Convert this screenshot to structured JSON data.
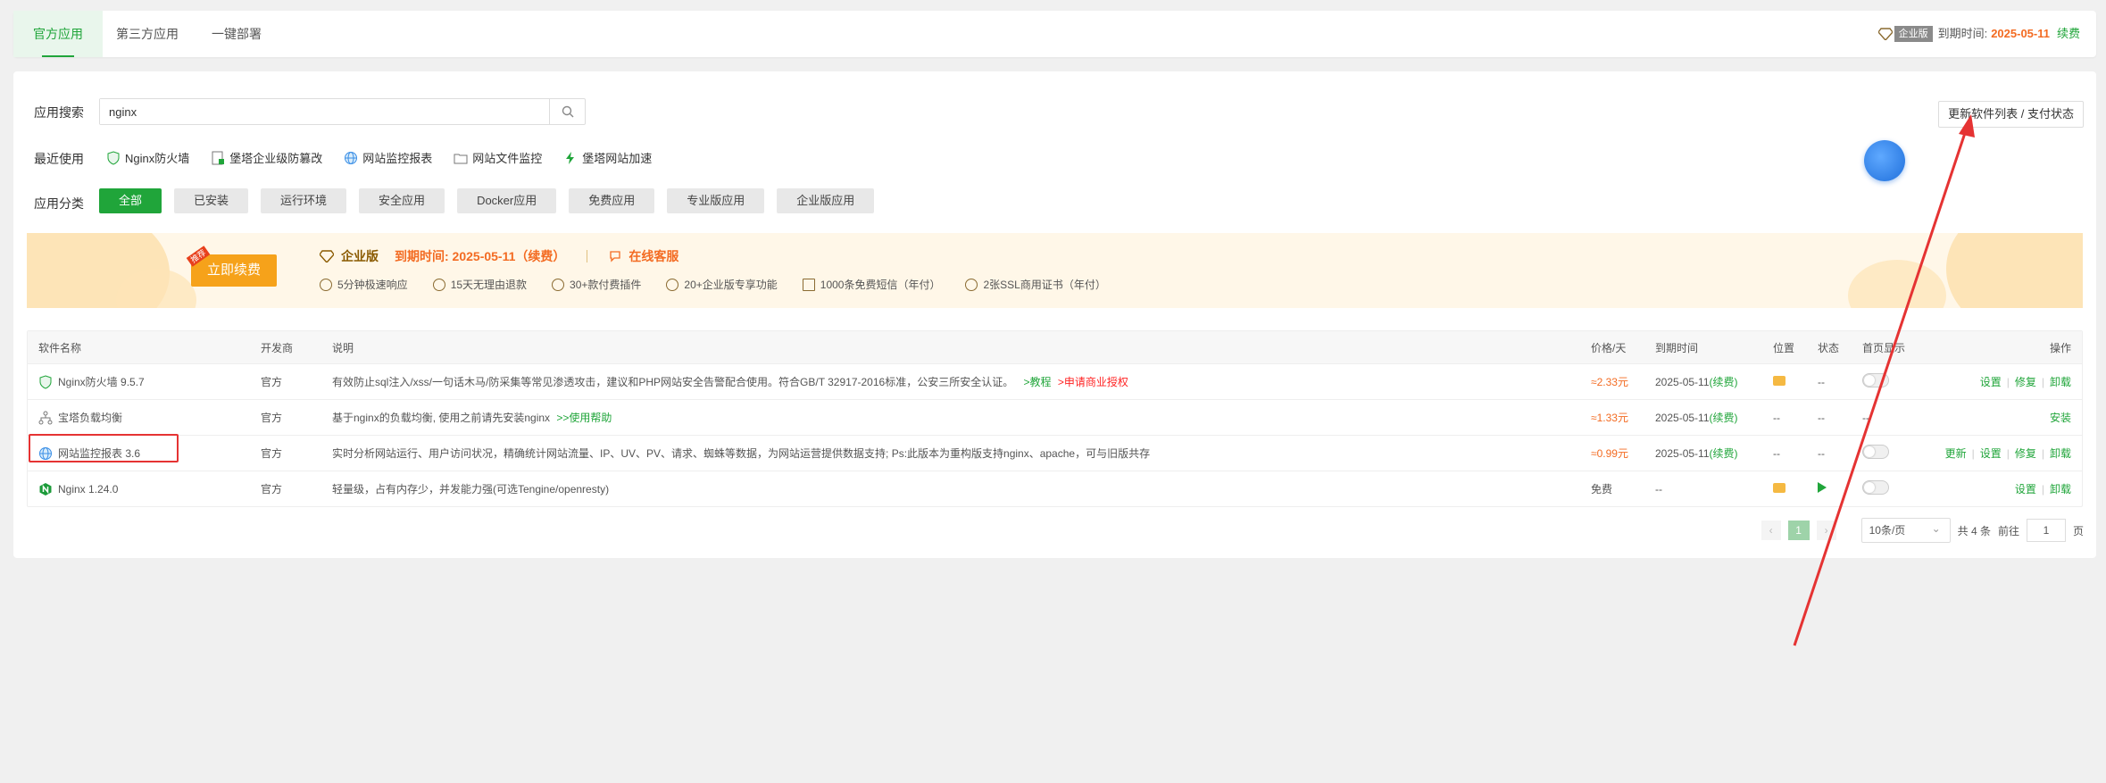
{
  "tabs": [
    "官方应用",
    "第三方应用",
    "一键部署"
  ],
  "expire_bar": {
    "badge": "企业版",
    "label": "到期时间:",
    "date": "2025-05-11",
    "renew": "续费"
  },
  "search": {
    "label": "应用搜索",
    "value": "nginx"
  },
  "update_button": "更新软件列表 / 支付状态",
  "recent": {
    "label": "最近使用",
    "items": [
      "Nginx防火墙",
      "堡塔企业级防篡改",
      "网站监控报表",
      "网站文件监控",
      "堡塔网站加速"
    ]
  },
  "category": {
    "label": "应用分类",
    "items": [
      "全部",
      "已安装",
      "运行环境",
      "安全应用",
      "Docker应用",
      "免费应用",
      "专业版应用",
      "企业版应用"
    ]
  },
  "banner": {
    "renew_btn": "立即续费",
    "renew_tag": "推荐",
    "edition": "企业版",
    "expire": "到期时间: 2025-05-11（续费）",
    "service": "在线客服",
    "features": [
      "5分钟极速响应",
      "15天无理由退款",
      "30+款付费插件",
      "20+企业版专享功能",
      "1000条免费短信（年付）",
      "2张SSL商用证书（年付）"
    ]
  },
  "table": {
    "headers": [
      "软件名称",
      "开发商",
      "说明",
      "价格/天",
      "到期时间",
      "位置",
      "状态",
      "首页显示",
      "操作"
    ],
    "rows": [
      {
        "name": "Nginx防火墙 9.5.7",
        "dev": "官方",
        "desc": "有效防止sql注入/xss/一句话木马/防采集等常见渗透攻击，建议和PHP网站安全告警配合使用。符合GB/T 32917-2016标准，公安三所安全认证。",
        "link1": ">教程",
        "link2": ">申请商业授权",
        "price": "≈2.33元",
        "exp": "2025-05-11",
        "exp_renew": "(续费)",
        "loc": "",
        "status": "--",
        "ops": [
          "设置",
          "修复",
          "卸载"
        ]
      },
      {
        "name": "宝塔负载均衡",
        "dev": "官方",
        "desc": "基于nginx的负载均衡, 使用之前请先安装nginx",
        "link1": ">>使用帮助",
        "link2": "",
        "price": "≈1.33元",
        "exp": "2025-05-11",
        "exp_renew": "(续费)",
        "loc": "--",
        "status": "--",
        "home": "--",
        "ops": [
          "安装"
        ]
      },
      {
        "name": "网站监控报表 3.6",
        "dev": "官方",
        "desc": "实时分析网站运行、用户访问状况，精确统计网站流量、IP、UV、PV、请求、蜘蛛等数据，为网站运营提供数据支持; Ps:此版本为重构版支持nginx、apache，可与旧版共存",
        "link1": "",
        "link2": "",
        "price": "≈0.99元",
        "exp": "2025-05-11",
        "exp_renew": "(续费)",
        "loc": "--",
        "status": "--",
        "ops": [
          "更新",
          "设置",
          "修复",
          "卸载"
        ]
      },
      {
        "name": "Nginx 1.24.0",
        "dev": "官方",
        "desc": "轻量级，占有内存少，并发能力强(可选Tengine/openresty)",
        "link1": "",
        "link2": "",
        "price": "免费",
        "exp": "--",
        "exp_renew": "",
        "loc": "",
        "status": "",
        "ops": [
          "设置",
          "卸载"
        ]
      }
    ]
  },
  "pager": {
    "prev": "‹",
    "page": "1",
    "next": "›",
    "per_page": "10条/页",
    "total": "共 4 条",
    "goto": "前往",
    "goto_value": "1",
    "unit": "页"
  },
  "colors": {
    "accent": "#20a53a",
    "price": "#f36b22",
    "highlight": "#e53333"
  }
}
